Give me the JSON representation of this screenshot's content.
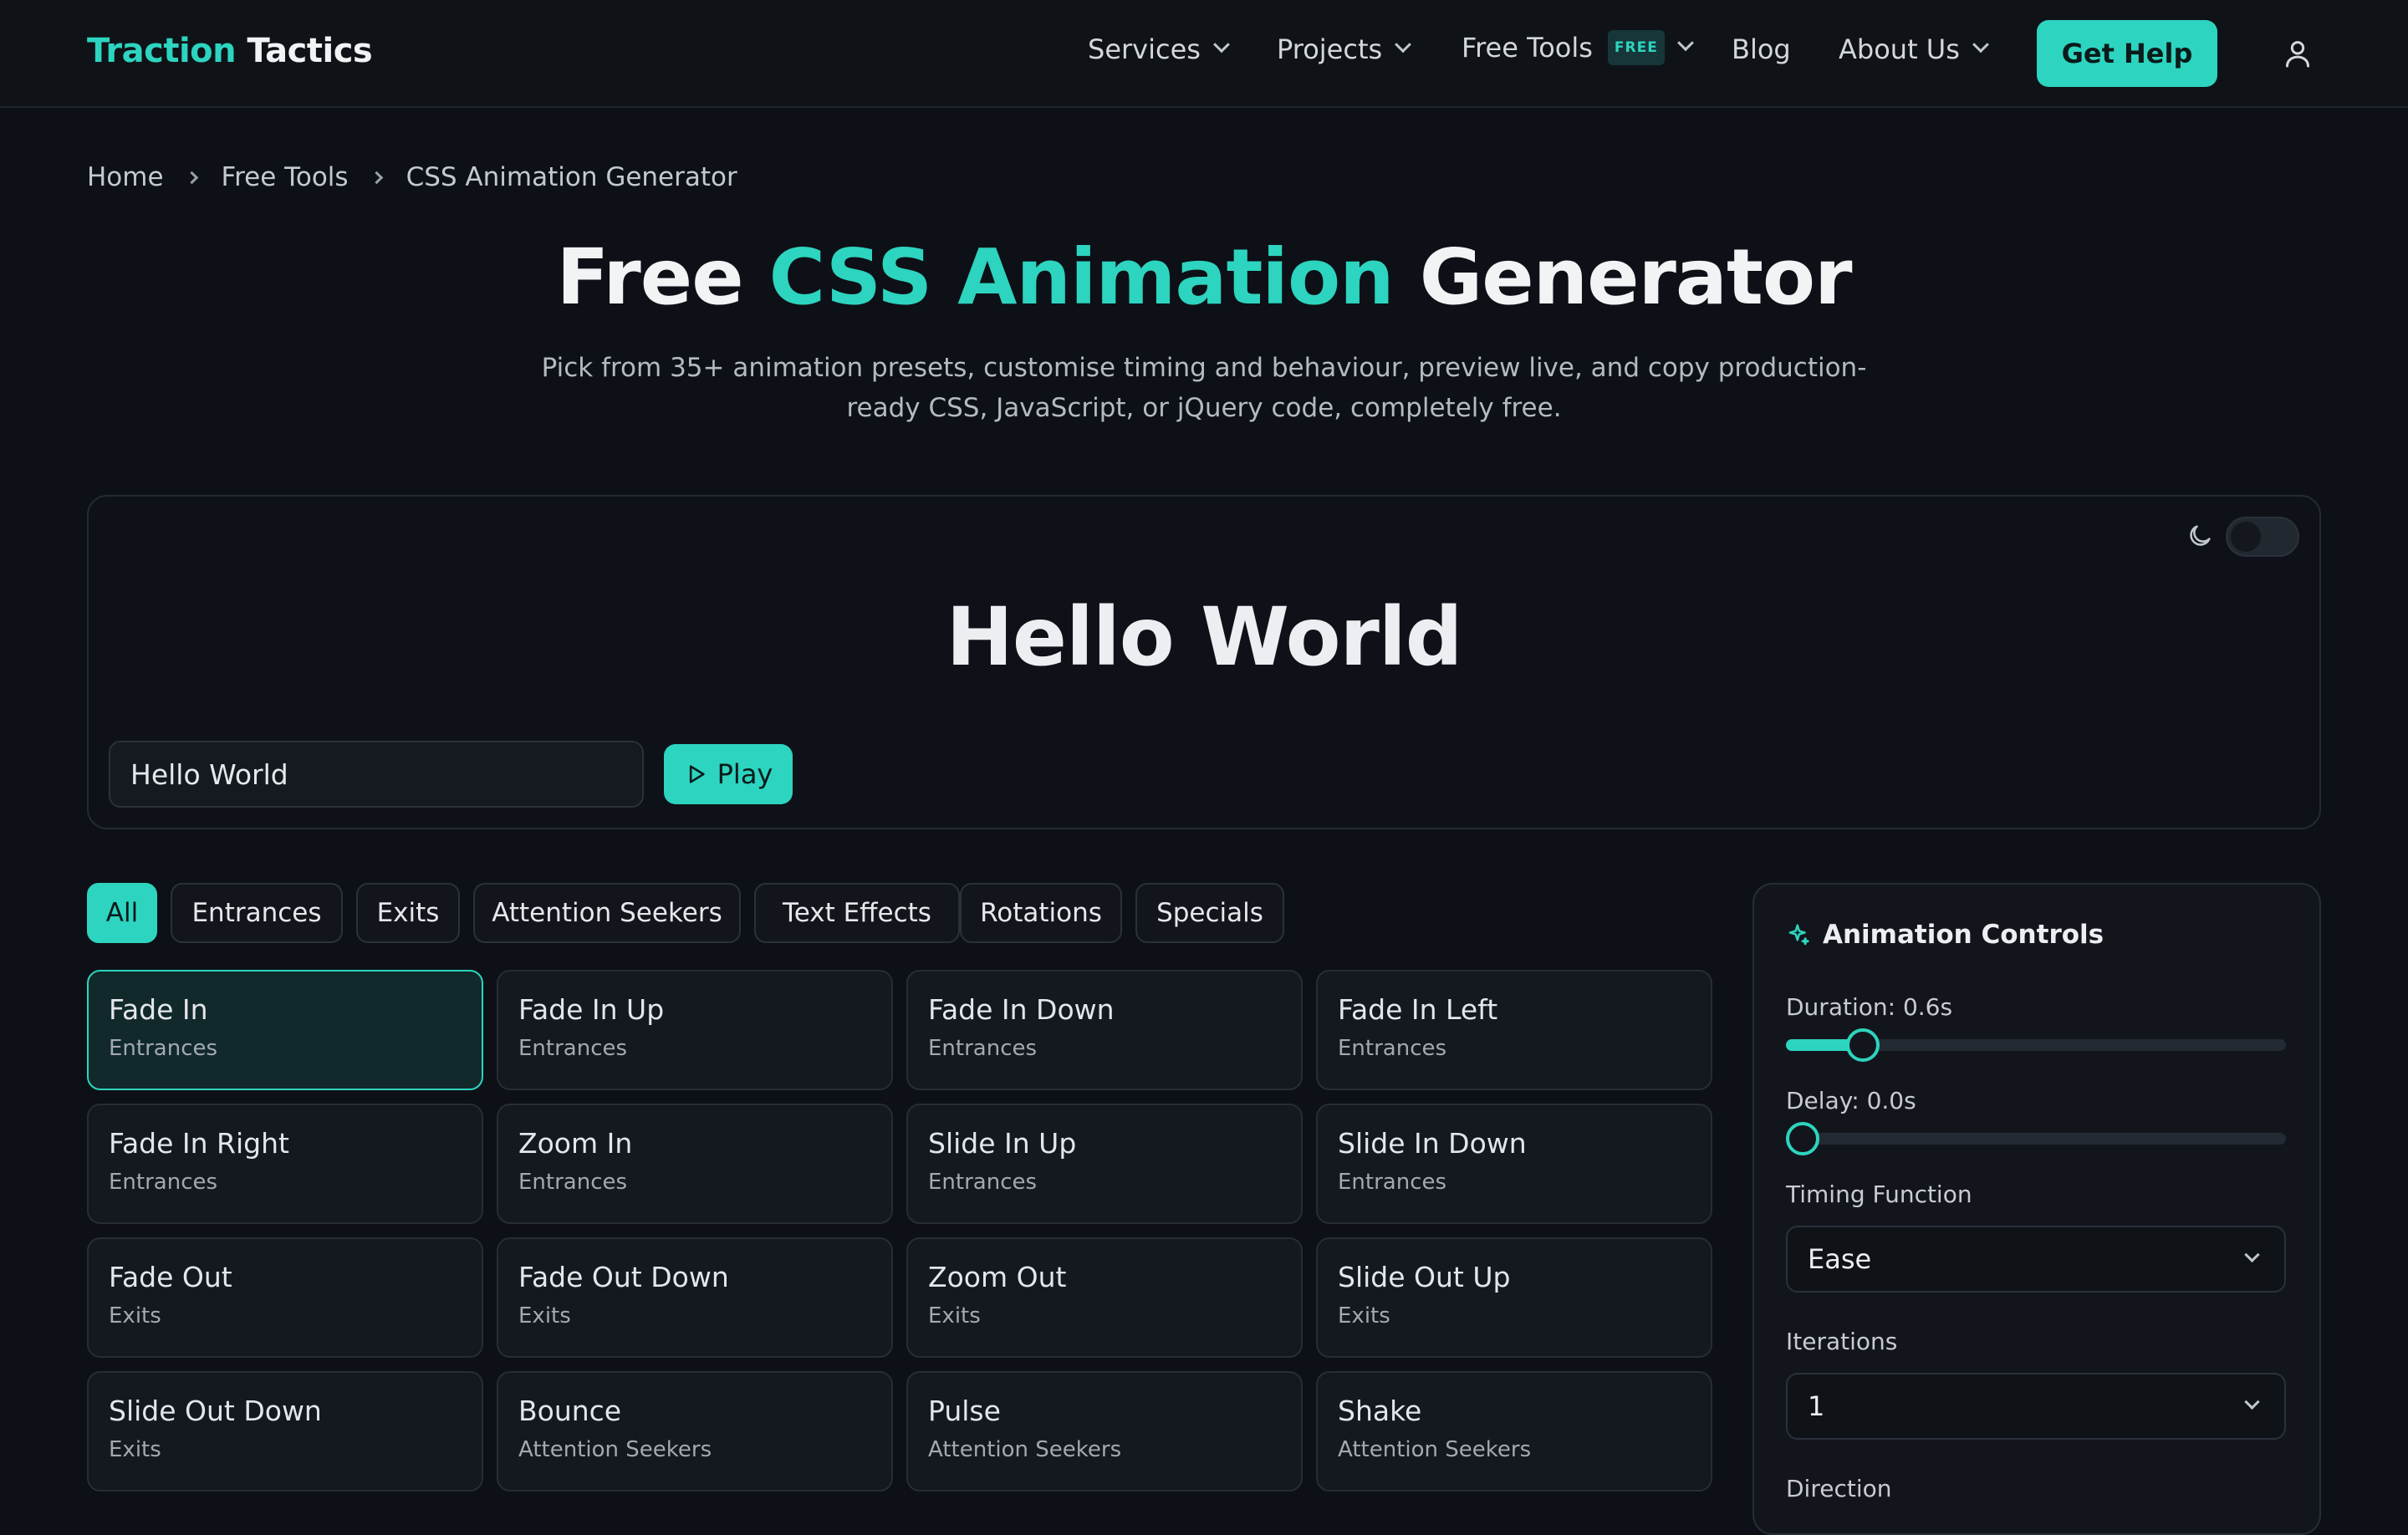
{
  "header": {
    "logo_part1": "Traction",
    "logo_part2": "Tactics",
    "nav": {
      "services": "Services",
      "projects": "Projects",
      "free_tools": "Free Tools",
      "free_badge": "FREE",
      "blog": "Blog",
      "about_us": "About Us"
    },
    "cta": "Get Help"
  },
  "breadcrumb": [
    "Home",
    "Free Tools",
    "CSS Animation Generator"
  ],
  "hero": {
    "title_pre": "Free ",
    "title_accent": "CSS Animation",
    "title_post": " Generator",
    "subtitle": "Pick from 35+ animation presets, customise timing and behaviour, preview live, and copy production-ready CSS, JavaScript, or jQuery code, completely free."
  },
  "preview": {
    "text": "Hello World",
    "input_value": "Hello World",
    "play_label": "Play",
    "dark_mode": false
  },
  "filters": [
    "All",
    "Entrances",
    "Exits",
    "Attention Seekers",
    "Text Effects",
    "Rotations",
    "Specials"
  ],
  "active_filter": "All",
  "cards": [
    {
      "name": "Fade In",
      "category": "Entrances"
    },
    {
      "name": "Fade In Up",
      "category": "Entrances"
    },
    {
      "name": "Fade In Down",
      "category": "Entrances"
    },
    {
      "name": "Fade In Left",
      "category": "Entrances"
    },
    {
      "name": "Fade In Right",
      "category": "Entrances"
    },
    {
      "name": "Zoom In",
      "category": "Entrances"
    },
    {
      "name": "Slide In Up",
      "category": "Entrances"
    },
    {
      "name": "Slide In Down",
      "category": "Entrances"
    },
    {
      "name": "Fade Out",
      "category": "Exits"
    },
    {
      "name": "Fade Out Down",
      "category": "Exits"
    },
    {
      "name": "Zoom Out",
      "category": "Exits"
    },
    {
      "name": "Slide Out Up",
      "category": "Exits"
    },
    {
      "name": "Slide Out Down",
      "category": "Exits"
    },
    {
      "name": "Bounce",
      "category": "Attention Seekers"
    },
    {
      "name": "Pulse",
      "category": "Attention Seekers"
    },
    {
      "name": "Shake",
      "category": "Attention Seekers"
    }
  ],
  "selected_card": "Fade In",
  "controls": {
    "title": "Animation Controls",
    "duration_label": "Duration: 0.6s",
    "duration_fraction": 0.12,
    "delay_label": "Delay: 0.0s",
    "delay_fraction": 0,
    "timing_label": "Timing Function",
    "timing_value": "Ease",
    "iterations_label": "Iterations",
    "iterations_value": "1",
    "direction_label": "Direction"
  },
  "colors": {
    "accent": "#2dd4bf",
    "background": "#0d1016"
  },
  "icons": [
    "chevron-down-icon",
    "chevron-right-icon",
    "user-icon",
    "moon-icon",
    "play-icon",
    "sparkle-icon"
  ]
}
